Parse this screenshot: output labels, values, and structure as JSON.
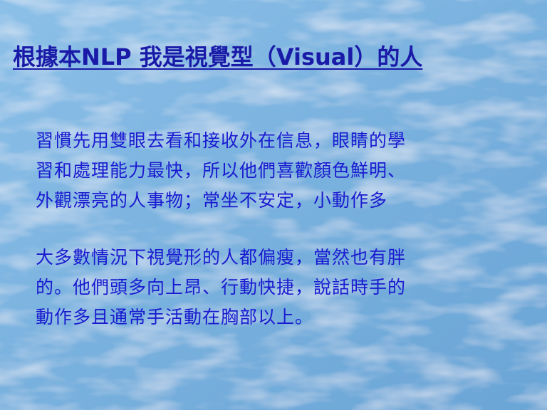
{
  "slide": {
    "title": "根據本NLP 我是視覺型（Visual）的人",
    "paragraphs": [
      {
        "lines": [
          "習慣先用雙眼去看和接收外在信息，眼睛的學",
          "習和處理能力最快，所以他們喜歡顏色鮮明、",
          "外觀漂亮的人事物；常坐不安定，小動作多"
        ]
      },
      {
        "lines": [
          "大多數情況下視覺形的人都偏瘦，當然也有胖",
          "的。他們頭多向上昂、行動快捷，說話時手的",
          "動作多且通常手活動在胸部以上。"
        ]
      }
    ]
  },
  "colors": {
    "background": "#7fb6e0",
    "title_text": "#1a1aa8",
    "body_text": "#1a1ad0"
  }
}
